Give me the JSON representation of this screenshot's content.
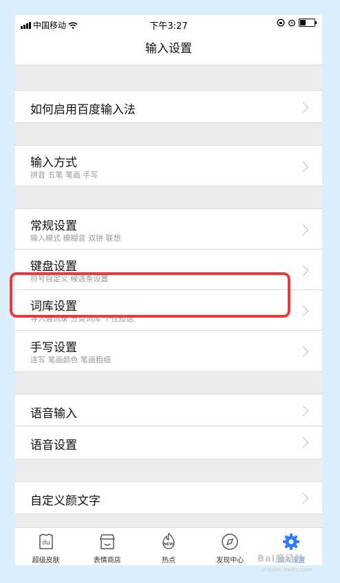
{
  "status": {
    "carrier": "中国移动",
    "time": "下午3:27"
  },
  "nav": {
    "title": "输入设置"
  },
  "rows": [
    {
      "label": "如何启用百度输入法",
      "sub": ""
    },
    {
      "label": "输入方式",
      "sub": "拼音 五笔 笔画 手写"
    },
    {
      "label": "常规设置",
      "sub": "输入模式 模糊音 双拼 联想"
    },
    {
      "label": "键盘设置",
      "sub": "符号自定义 候选条设置"
    },
    {
      "label": "词库设置",
      "sub": "导入通讯录 分类词库 个性短语"
    },
    {
      "label": "手写设置",
      "sub": "连写 笔画颜色 笔画粗细"
    },
    {
      "label": "语音输入",
      "sub": ""
    },
    {
      "label": "语音设置",
      "sub": ""
    },
    {
      "label": "自定义颜文字",
      "sub": ""
    }
  ],
  "tabs": [
    {
      "label": "超级皮肤",
      "icon": "skin-icon"
    },
    {
      "label": "表情商店",
      "icon": "store-icon"
    },
    {
      "label": "热点",
      "icon": "hot-new-icon",
      "badge": "NEW"
    },
    {
      "label": "发现中心",
      "icon": "compass-icon"
    },
    {
      "label": "输入设置",
      "icon": "gear-icon",
      "active": true
    }
  ],
  "watermark": {
    "text": "Bai度经验",
    "url": "jingyan.baidu.com"
  },
  "colors": {
    "accent": "#2f7df6",
    "highlight": "#e33c3c",
    "background": "#ececee"
  }
}
